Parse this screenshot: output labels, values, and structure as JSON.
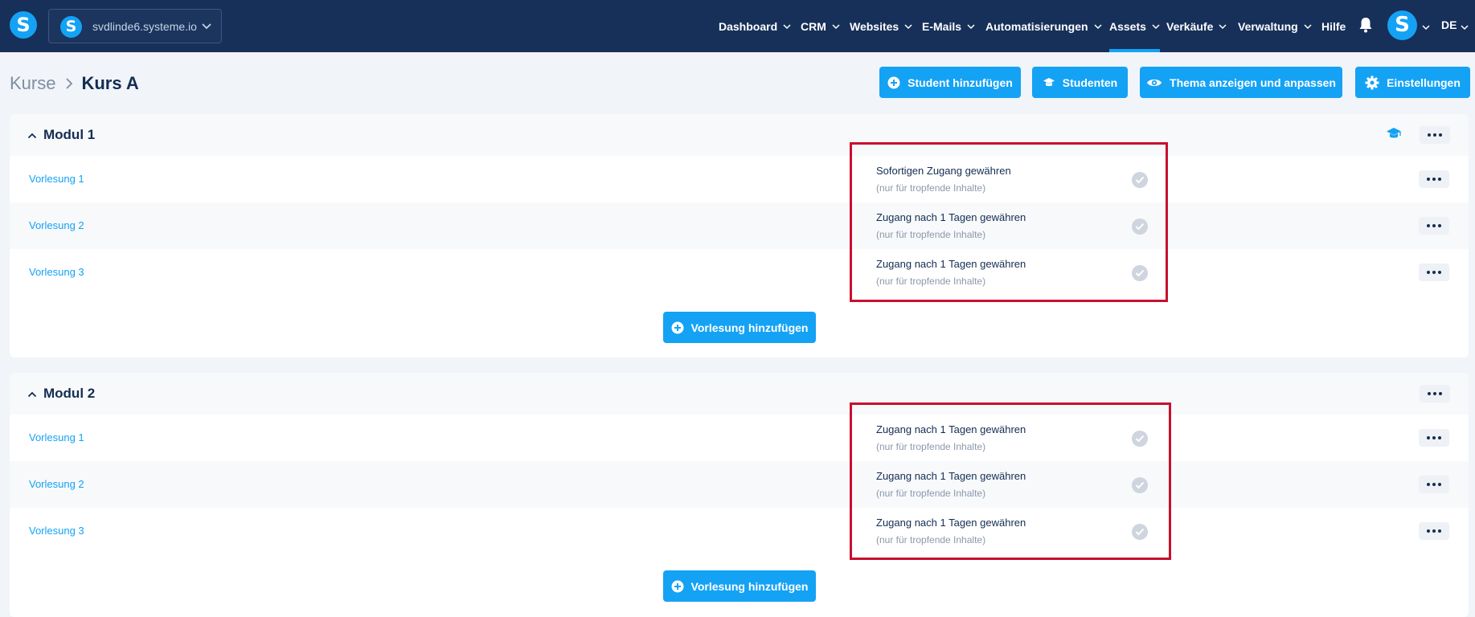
{
  "app": {
    "site_name": "svdlinde6.systeme.io",
    "nav": [
      "Dashboard",
      "CRM",
      "Websites",
      "E-Mails",
      "Automatisierungen",
      "Assets",
      "Verkäufe",
      "Verwaltung",
      "Hilfe"
    ],
    "active_nav": "Assets",
    "language": "DE",
    "brand_letter": "S"
  },
  "breadcrumb": {
    "root": "Kurse",
    "current": "Kurs A"
  },
  "actions": {
    "add_student": "Student hinzufügen",
    "students": "Studenten",
    "theme": "Thema anzeigen und anpassen",
    "settings": "Einstellungen"
  },
  "modules": [
    {
      "title": "Modul 1",
      "lectures": [
        {
          "name": "Vorlesung 1",
          "access": "Sofortigen Zugang gewähren",
          "note": "(nur für tropfende Inhalte)"
        },
        {
          "name": "Vorlesung 2",
          "access": "Zugang nach 1 Tagen gewähren",
          "note": "(nur für tropfende Inhalte)"
        },
        {
          "name": "Vorlesung 3",
          "access": "Zugang nach 1 Tagen gewähren",
          "note": "(nur für tropfende Inhalte)"
        }
      ],
      "add_label": "Vorlesung hinzufügen"
    },
    {
      "title": "Modul 2",
      "lectures": [
        {
          "name": "Vorlesung 1",
          "access": "Zugang nach 1 Tagen gewähren",
          "note": "(nur für tropfende Inhalte)"
        },
        {
          "name": "Vorlesung 2",
          "access": "Zugang nach 1 Tagen gewähren",
          "note": "(nur für tropfende Inhalte)"
        },
        {
          "name": "Vorlesung 3",
          "access": "Zugang nach 1 Tagen gewähren",
          "note": "(nur für tropfende Inhalte)"
        }
      ],
      "add_label": "Vorlesung hinzufügen"
    }
  ],
  "colors": {
    "topbar": "#17305a",
    "accent": "#14a2f5",
    "highlight": "#c8102e"
  }
}
